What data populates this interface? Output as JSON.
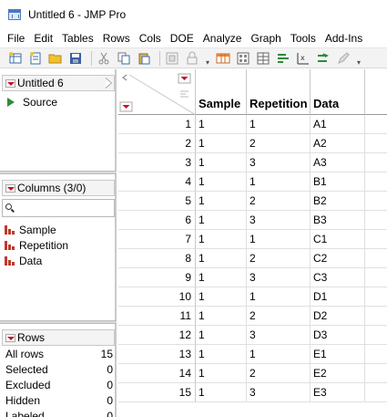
{
  "window": {
    "title": "Untitled 6 - JMP Pro"
  },
  "menu": [
    "File",
    "Edit",
    "Tables",
    "Rows",
    "Cols",
    "DOE",
    "Analyze",
    "Graph",
    "Tools",
    "Add-Ins"
  ],
  "toolbar": {
    "icons": [
      "new-table-icon",
      "new-script-icon",
      "open-icon",
      "save-icon",
      "cut-icon",
      "copy-icon",
      "paste-icon",
      "select-icon",
      "lock-icon",
      "table-icon",
      "calculator-icon",
      "columns-icon",
      "distribution-icon",
      "fit-icon",
      "arrow-icon",
      "edit-icon"
    ]
  },
  "table_panel": {
    "title": "Untitled 6",
    "source_label": "Source"
  },
  "columns_panel": {
    "title": "Columns (3/0)",
    "search_placeholder": "",
    "items": [
      "Sample",
      "Repetition",
      "Data"
    ]
  },
  "rows_panel": {
    "title": "Rows",
    "items": [
      {
        "label": "All rows",
        "value": "15"
      },
      {
        "label": "Selected",
        "value": "0"
      },
      {
        "label": "Excluded",
        "value": "0"
      },
      {
        "label": "Hidden",
        "value": "0"
      },
      {
        "label": "Labeled",
        "value": "0"
      }
    ]
  },
  "grid": {
    "headers": [
      "Sample",
      "Repetition",
      "Data"
    ],
    "rows": [
      [
        "1",
        "1",
        "1",
        "A1"
      ],
      [
        "2",
        "1",
        "2",
        "A2"
      ],
      [
        "3",
        "1",
        "3",
        "A3"
      ],
      [
        "4",
        "1",
        "1",
        "B1"
      ],
      [
        "5",
        "1",
        "2",
        "B2"
      ],
      [
        "6",
        "1",
        "3",
        "B3"
      ],
      [
        "7",
        "1",
        "1",
        "C1"
      ],
      [
        "8",
        "1",
        "2",
        "C2"
      ],
      [
        "9",
        "1",
        "3",
        "C3"
      ],
      [
        "10",
        "1",
        "1",
        "D1"
      ],
      [
        "11",
        "1",
        "2",
        "D2"
      ],
      [
        "12",
        "1",
        "3",
        "D3"
      ],
      [
        "13",
        "1",
        "1",
        "E1"
      ],
      [
        "14",
        "1",
        "2",
        "E2"
      ],
      [
        "15",
        "1",
        "3",
        "E3"
      ]
    ]
  },
  "colors": {
    "accent_red": "#c8102e",
    "source_green": "#2e8b3a",
    "column_icon_red": "#c0392b"
  }
}
